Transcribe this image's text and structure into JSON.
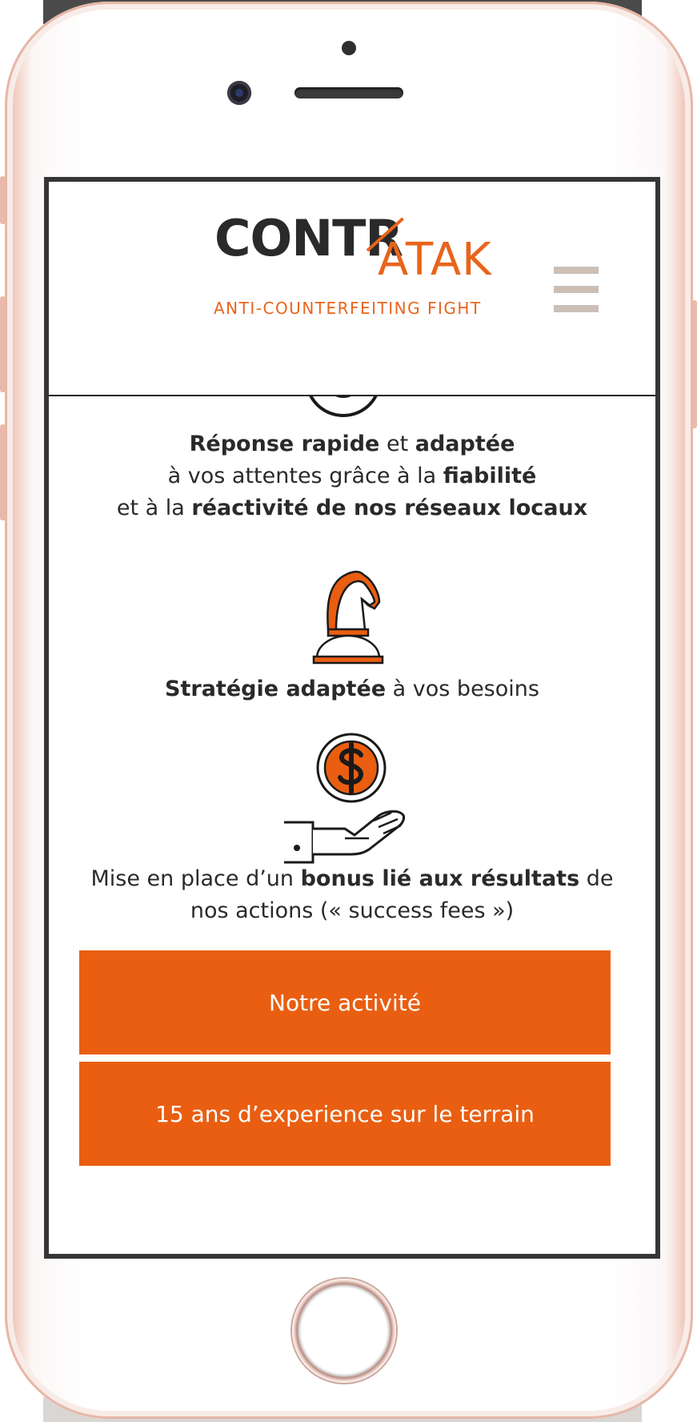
{
  "header": {
    "logo_main": "CONTR",
    "logo_accent": "ATAK",
    "logo_tagline": "ANTI-COUNTERFEITING FIGHT",
    "menu_icon": "hamburger-menu-icon"
  },
  "features": [
    {
      "icon": "target-icon",
      "parts": [
        [
          "Réponse rapide",
          " et ",
          "adaptée"
        ],
        [
          "à vos attentes grâce à la ",
          "fiabilité"
        ],
        [
          "et à la ",
          "réactivité de nos réseaux locaux"
        ]
      ]
    },
    {
      "icon": "chess-knight-icon",
      "parts": [
        [
          "Stratégie adaptée",
          " à vos besoins"
        ]
      ]
    },
    {
      "icon": "hand-dollar-coin-icon",
      "parts": [
        [
          "Mise en place d’un ",
          "bonus lié aux résultats",
          " de"
        ],
        [
          "nos actions (« success fees »)"
        ]
      ]
    }
  ],
  "buttons": {
    "activity": "Notre activité",
    "experience": "15 ans d’experience sur le terrain"
  },
  "colors": {
    "accent": "#e95e11",
    "text": "#2a2a2a",
    "menu": "#cbbfb6"
  }
}
